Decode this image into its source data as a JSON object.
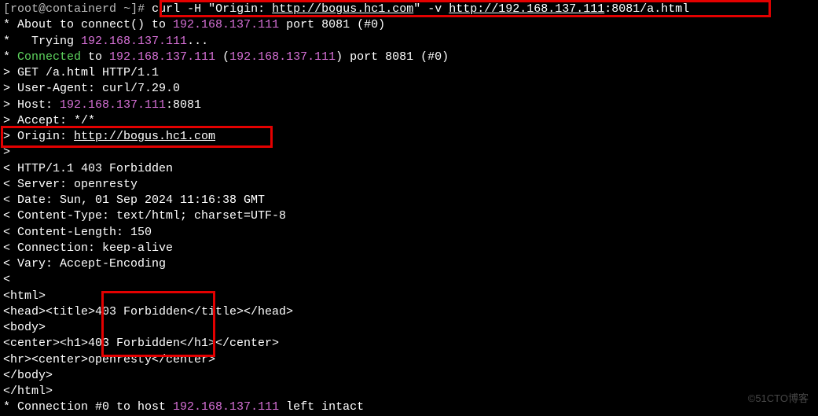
{
  "prompt": {
    "user": "root",
    "host": "containerd",
    "path": "~",
    "symbol": "#"
  },
  "cmd": {
    "curl": "curl -H \"Origin: ",
    "origin_url": "http://bogus.hc1.com",
    "after_origin": "\" -v ",
    "target_scheme": "http://192.168.137.111",
    "target_rest": ":8081/a.html"
  },
  "conn": {
    "about_a": "* About to connect() to ",
    "about_ip": "192.168.137.111",
    "about_b": " port 8081 (#0)",
    "trying_a": "*   Trying ",
    "trying_ip": "192.168.137.111",
    "trying_b": "...",
    "connected_a": "* ",
    "connected_word": "Connected",
    "connected_b": " to ",
    "connected_ip1": "192.168.137.111",
    "connected_c": " (",
    "connected_ip2": "192.168.137.111",
    "connected_d": ") port 8081 (#0)"
  },
  "req": {
    "get": "> GET /a.html HTTP/1.1",
    "ua": "> User-Agent: curl/7.29.0",
    "host_a": "> Host: ",
    "host_ip": "192.168.137.111",
    "host_b": ":8081",
    "accept": "> Accept: */*",
    "origin_a": "> Origin: ",
    "origin_url": "http://bogus.hc1.com",
    "end": "> "
  },
  "resp": {
    "status": "< HTTP/1.1 403 Forbidden",
    "server": "< Server: openresty",
    "date": "< Date: Sun, 01 Sep 2024 11:16:38 GMT",
    "ctype": "< Content-Type: text/html; charset=UTF-8",
    "clen": "< Content-Length: 150",
    "conn": "< Connection: keep-alive",
    "vary": "< Vary: Accept-Encoding",
    "end": "< "
  },
  "body": {
    "l1": "<html>",
    "l2": "<head><title>403 Forbidden</title></head>",
    "l3": "<body>",
    "l4": "<center><h1>403 Forbidden</h1></center>",
    "l5": "<hr><center>openresty</center>",
    "l6": "</body>",
    "l7": "</html>"
  },
  "tail": {
    "a": "* Connection #0 to host ",
    "ip": "192.168.137.111",
    "b": " left intact"
  },
  "watermark": "©51CTO博客"
}
